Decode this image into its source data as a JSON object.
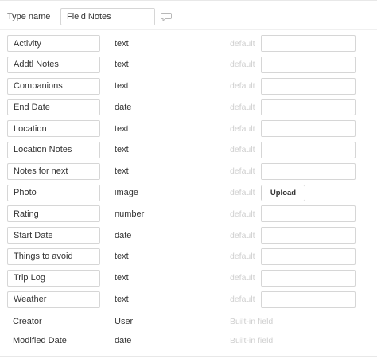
{
  "type_name": {
    "label": "Type name",
    "value": "Field Notes",
    "comment_icon": "speech-bubble-icon"
  },
  "fields": [
    {
      "name": "Activity",
      "type": "text",
      "default_label": "default",
      "control": "input"
    },
    {
      "name": "Addtl Notes",
      "type": "text",
      "default_label": "default",
      "control": "input"
    },
    {
      "name": "Companions",
      "type": "text",
      "default_label": "default",
      "control": "input"
    },
    {
      "name": "End Date",
      "type": "date",
      "default_label": "default",
      "control": "input"
    },
    {
      "name": "Location",
      "type": "text",
      "default_label": "default",
      "control": "input"
    },
    {
      "name": "Location Notes",
      "type": "text",
      "default_label": "default",
      "control": "input"
    },
    {
      "name": "Notes for next",
      "type": "text",
      "default_label": "default",
      "control": "input"
    },
    {
      "name": "Photo",
      "type": "image",
      "default_label": "default",
      "control": "upload",
      "button_label": "Upload"
    },
    {
      "name": "Rating",
      "type": "number",
      "default_label": "default",
      "control": "input"
    },
    {
      "name": "Start Date",
      "type": "date",
      "default_label": "default",
      "control": "input"
    },
    {
      "name": "Things to avoid",
      "type": "text",
      "default_label": "default",
      "control": "input"
    },
    {
      "name": "Trip Log",
      "type": "text",
      "default_label": "default",
      "control": "input"
    },
    {
      "name": "Weather",
      "type": "text",
      "default_label": "default",
      "control": "input"
    }
  ],
  "builtin_fields": [
    {
      "name": "Creator",
      "type": "User",
      "label": "Built-in field"
    },
    {
      "name": "Modified Date",
      "type": "date",
      "label": "Built-in field"
    }
  ],
  "colors": {
    "border": "#d6d6d6",
    "muted_text": "#cfcfcf",
    "text": "#333333"
  }
}
